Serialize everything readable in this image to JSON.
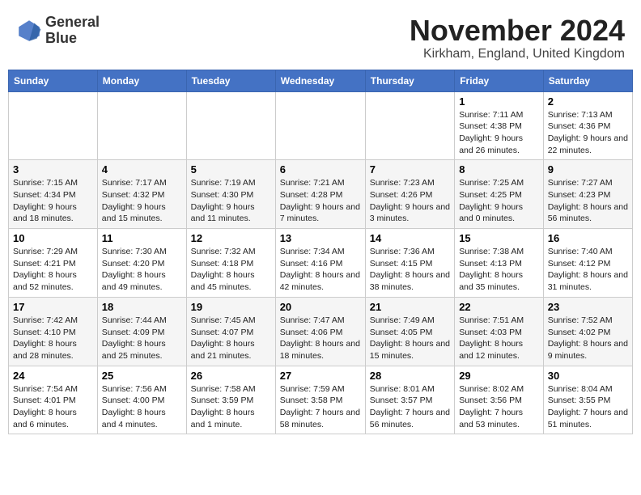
{
  "header": {
    "logo_line1": "General",
    "logo_line2": "Blue",
    "main_title": "November 2024",
    "subtitle": "Kirkham, England, United Kingdom"
  },
  "weekdays": [
    "Sunday",
    "Monday",
    "Tuesday",
    "Wednesday",
    "Thursday",
    "Friday",
    "Saturday"
  ],
  "weeks": [
    [
      {
        "day": "",
        "info": ""
      },
      {
        "day": "",
        "info": ""
      },
      {
        "day": "",
        "info": ""
      },
      {
        "day": "",
        "info": ""
      },
      {
        "day": "",
        "info": ""
      },
      {
        "day": "1",
        "info": "Sunrise: 7:11 AM\nSunset: 4:38 PM\nDaylight: 9 hours and 26 minutes."
      },
      {
        "day": "2",
        "info": "Sunrise: 7:13 AM\nSunset: 4:36 PM\nDaylight: 9 hours and 22 minutes."
      }
    ],
    [
      {
        "day": "3",
        "info": "Sunrise: 7:15 AM\nSunset: 4:34 PM\nDaylight: 9 hours and 18 minutes."
      },
      {
        "day": "4",
        "info": "Sunrise: 7:17 AM\nSunset: 4:32 PM\nDaylight: 9 hours and 15 minutes."
      },
      {
        "day": "5",
        "info": "Sunrise: 7:19 AM\nSunset: 4:30 PM\nDaylight: 9 hours and 11 minutes."
      },
      {
        "day": "6",
        "info": "Sunrise: 7:21 AM\nSunset: 4:28 PM\nDaylight: 9 hours and 7 minutes."
      },
      {
        "day": "7",
        "info": "Sunrise: 7:23 AM\nSunset: 4:26 PM\nDaylight: 9 hours and 3 minutes."
      },
      {
        "day": "8",
        "info": "Sunrise: 7:25 AM\nSunset: 4:25 PM\nDaylight: 9 hours and 0 minutes."
      },
      {
        "day": "9",
        "info": "Sunrise: 7:27 AM\nSunset: 4:23 PM\nDaylight: 8 hours and 56 minutes."
      }
    ],
    [
      {
        "day": "10",
        "info": "Sunrise: 7:29 AM\nSunset: 4:21 PM\nDaylight: 8 hours and 52 minutes."
      },
      {
        "day": "11",
        "info": "Sunrise: 7:30 AM\nSunset: 4:20 PM\nDaylight: 8 hours and 49 minutes."
      },
      {
        "day": "12",
        "info": "Sunrise: 7:32 AM\nSunset: 4:18 PM\nDaylight: 8 hours and 45 minutes."
      },
      {
        "day": "13",
        "info": "Sunrise: 7:34 AM\nSunset: 4:16 PM\nDaylight: 8 hours and 42 minutes."
      },
      {
        "day": "14",
        "info": "Sunrise: 7:36 AM\nSunset: 4:15 PM\nDaylight: 8 hours and 38 minutes."
      },
      {
        "day": "15",
        "info": "Sunrise: 7:38 AM\nSunset: 4:13 PM\nDaylight: 8 hours and 35 minutes."
      },
      {
        "day": "16",
        "info": "Sunrise: 7:40 AM\nSunset: 4:12 PM\nDaylight: 8 hours and 31 minutes."
      }
    ],
    [
      {
        "day": "17",
        "info": "Sunrise: 7:42 AM\nSunset: 4:10 PM\nDaylight: 8 hours and 28 minutes."
      },
      {
        "day": "18",
        "info": "Sunrise: 7:44 AM\nSunset: 4:09 PM\nDaylight: 8 hours and 25 minutes."
      },
      {
        "day": "19",
        "info": "Sunrise: 7:45 AM\nSunset: 4:07 PM\nDaylight: 8 hours and 21 minutes."
      },
      {
        "day": "20",
        "info": "Sunrise: 7:47 AM\nSunset: 4:06 PM\nDaylight: 8 hours and 18 minutes."
      },
      {
        "day": "21",
        "info": "Sunrise: 7:49 AM\nSunset: 4:05 PM\nDaylight: 8 hours and 15 minutes."
      },
      {
        "day": "22",
        "info": "Sunrise: 7:51 AM\nSunset: 4:03 PM\nDaylight: 8 hours and 12 minutes."
      },
      {
        "day": "23",
        "info": "Sunrise: 7:52 AM\nSunset: 4:02 PM\nDaylight: 8 hours and 9 minutes."
      }
    ],
    [
      {
        "day": "24",
        "info": "Sunrise: 7:54 AM\nSunset: 4:01 PM\nDaylight: 8 hours and 6 minutes."
      },
      {
        "day": "25",
        "info": "Sunrise: 7:56 AM\nSunset: 4:00 PM\nDaylight: 8 hours and 4 minutes."
      },
      {
        "day": "26",
        "info": "Sunrise: 7:58 AM\nSunset: 3:59 PM\nDaylight: 8 hours and 1 minute."
      },
      {
        "day": "27",
        "info": "Sunrise: 7:59 AM\nSunset: 3:58 PM\nDaylight: 7 hours and 58 minutes."
      },
      {
        "day": "28",
        "info": "Sunrise: 8:01 AM\nSunset: 3:57 PM\nDaylight: 7 hours and 56 minutes."
      },
      {
        "day": "29",
        "info": "Sunrise: 8:02 AM\nSunset: 3:56 PM\nDaylight: 7 hours and 53 minutes."
      },
      {
        "day": "30",
        "info": "Sunrise: 8:04 AM\nSunset: 3:55 PM\nDaylight: 7 hours and 51 minutes."
      }
    ]
  ]
}
